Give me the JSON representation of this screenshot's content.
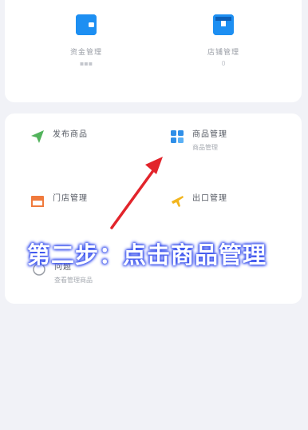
{
  "top_card": {
    "items": [
      {
        "label": "资金管理",
        "sub": "▪▪▪",
        "icon": "wallet-icon"
      },
      {
        "label": "店铺管理",
        "sub": "0",
        "icon": "shop-box-icon"
      }
    ]
  },
  "menu": {
    "items": [
      {
        "label": "发布商品",
        "sub": "",
        "icon": "send-plane-icon",
        "color": "#52b35c"
      },
      {
        "label": "商品管理",
        "sub": "商品管理",
        "icon": "grid-icon",
        "color": "#2f8fe8"
      },
      {
        "label": "门店管理",
        "sub": "",
        "icon": "store-icon",
        "color": "#f07a3c"
      },
      {
        "label": "出口管理",
        "sub": "",
        "icon": "airplane-icon",
        "color": "#f2b51e"
      },
      {
        "label": "问题",
        "sub": "查看管理商品",
        "icon": "",
        "color": ""
      }
    ]
  },
  "overlay": {
    "text": "第二步：点击商品管理",
    "color": "#ffffff",
    "outline": "#3d55ee"
  },
  "arrow": {
    "color": "#e2242b"
  }
}
